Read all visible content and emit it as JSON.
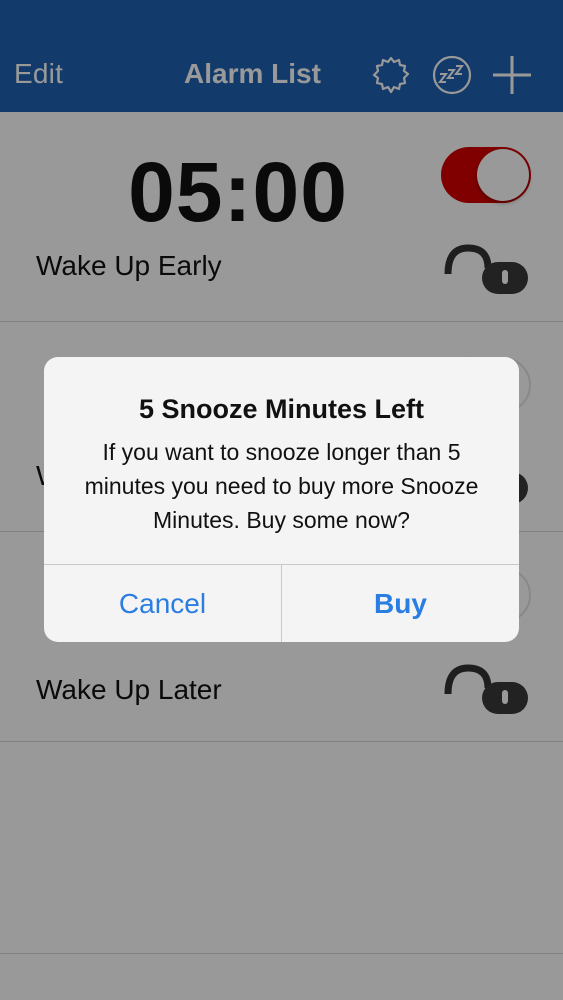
{
  "navbar": {
    "edit_label": "Edit",
    "title": "Alarm List",
    "icons": [
      "gear-icon",
      "snooze-zzz-icon",
      "plus-icon"
    ],
    "background_color": "#1f63b5"
  },
  "alarms": [
    {
      "time": "05:00",
      "label": "Wake Up Early",
      "enabled": true,
      "locked": false
    },
    {
      "time": "",
      "label": "W",
      "enabled": false,
      "locked": false
    },
    {
      "time": "",
      "label": "Wake Up Later",
      "enabled": false,
      "locked": false
    }
  ],
  "alert": {
    "title": "5 Snooze Minutes Left",
    "message": "If you want to snooze longer than 5 minutes you need to buy more Snooze Minutes. Buy some now?",
    "cancel_label": "Cancel",
    "buy_label": "Buy",
    "button_color": "#2a7de1"
  },
  "colors": {
    "toggle_on": "#d50000",
    "overlay": "rgba(0,0,0,0.40)"
  }
}
